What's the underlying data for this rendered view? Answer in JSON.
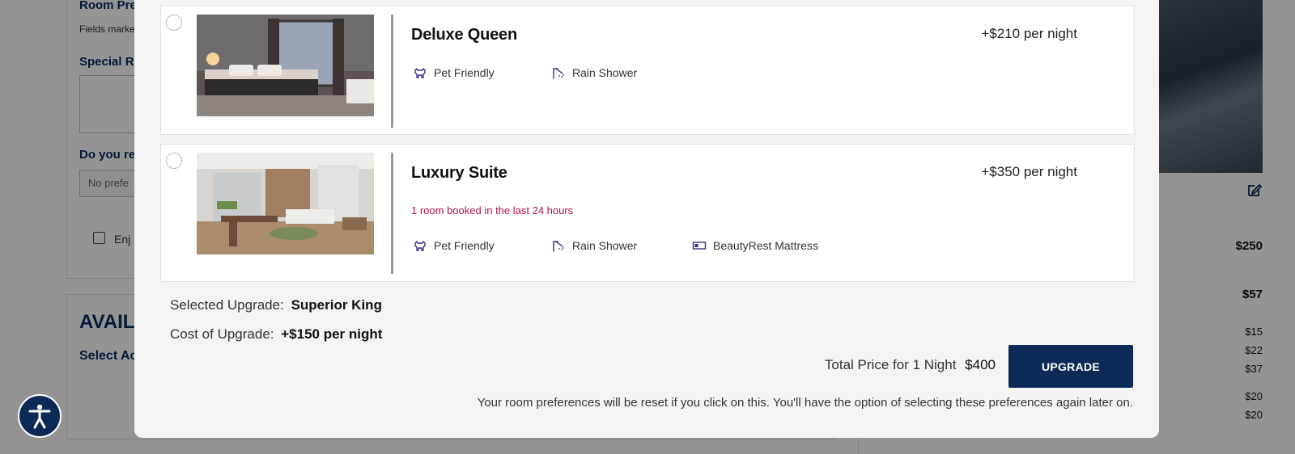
{
  "background": {
    "room_pref_heading": "Room Pre",
    "fields_marked": "Fields marke",
    "special_requests_label": "Special Re",
    "do_you_require_label": "Do you req",
    "select_placeholder": "No prefe",
    "checkbox_label": "Enj",
    "available_heading": "AVAIL",
    "select_ac_label": "Select Ac",
    "prices": [
      "$250",
      "$57",
      "$15",
      "$22",
      "$37",
      "$20",
      "$20"
    ]
  },
  "modal": {
    "rooms": [
      {
        "name": "Deluxe Queen",
        "price": "+$210 per night",
        "booked_note": "",
        "amenities": [
          {
            "icon": "pet-icon",
            "label": "Pet Friendly"
          },
          {
            "icon": "shower-icon",
            "label": "Rain Shower"
          }
        ]
      },
      {
        "name": "Luxury Suite",
        "price": "+$350 per night",
        "booked_note": "1 room booked in the last 24 hours",
        "amenities": [
          {
            "icon": "pet-icon",
            "label": "Pet Friendly"
          },
          {
            "icon": "shower-icon",
            "label": "Rain Shower"
          },
          {
            "icon": "mattress-icon",
            "label": "BeautyRest Mattress"
          }
        ]
      }
    ],
    "selected_upgrade_label": "Selected Upgrade:",
    "selected_upgrade_value": "Superior King",
    "cost_label": "Cost of Upgrade:",
    "cost_value": "+$150 per night",
    "total_label": "Total Price for 1 Night",
    "total_value": "$400",
    "upgrade_button": "UPGRADE",
    "notice": "Your room preferences will be reset if you click on this. You'll have the option of selecting these preferences again later on."
  },
  "colors": {
    "brand_navy": "#0b2a56",
    "booked_red": "#b3144b",
    "amenity_icon": "#3a2a8a"
  }
}
